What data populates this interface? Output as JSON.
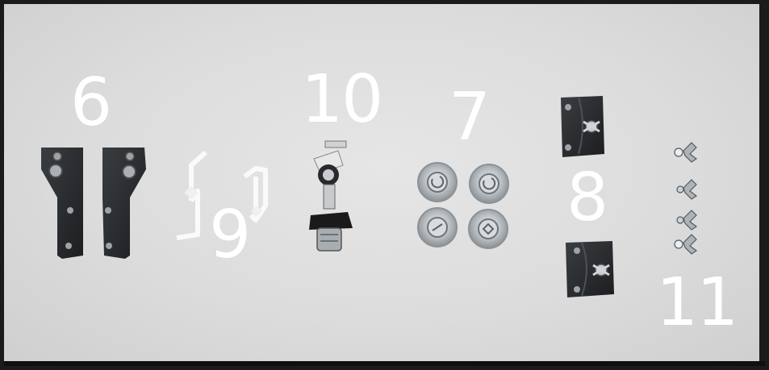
{
  "labels": {
    "six": "6",
    "nine": "9",
    "ten": "10",
    "seven": "7",
    "eight": "8",
    "eleven": "11"
  },
  "colors": {
    "background": "#dcdcdc",
    "label": "#ffffff",
    "plate": "#26282b",
    "metal": "#b8bcc0"
  }
}
